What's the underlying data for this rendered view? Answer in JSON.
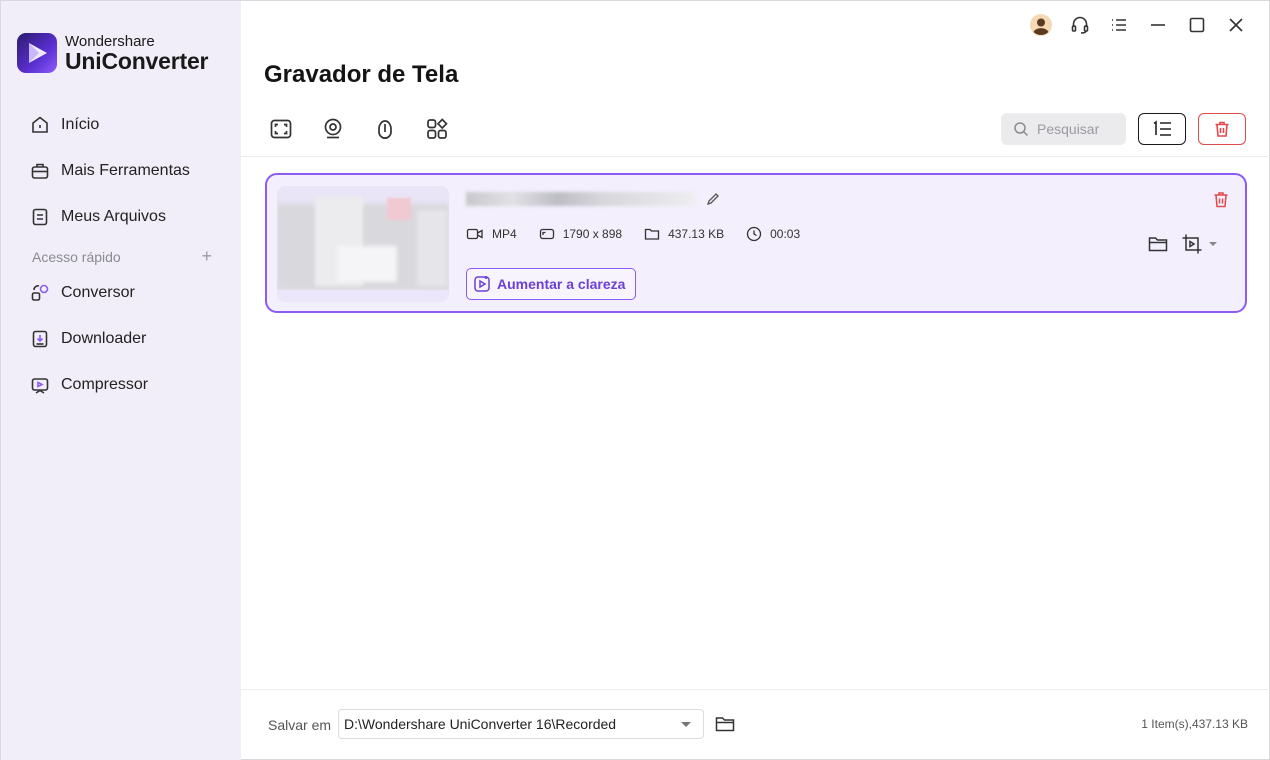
{
  "brand": {
    "top": "Wondershare",
    "main": "UniConverter"
  },
  "sidebar": {
    "items": [
      {
        "label": "Início",
        "icon": "home-icon"
      },
      {
        "label": "Mais Ferramentas",
        "icon": "toolbox-icon"
      },
      {
        "label": "Meus Arquivos",
        "icon": "files-icon"
      }
    ],
    "quick_access_label": "Acesso rápido",
    "quick_add": "+",
    "quick_items": [
      {
        "label": "Conversor",
        "icon": "converter-icon"
      },
      {
        "label": "Downloader",
        "icon": "downloader-icon"
      },
      {
        "label": "Compressor",
        "icon": "compressor-icon"
      }
    ]
  },
  "page": {
    "title": "Gravador de Tela"
  },
  "toolbar": {
    "icons": [
      "screen-record-icon",
      "webcam-record-icon",
      "audio-record-icon",
      "apps-grid-icon"
    ],
    "search_placeholder": "Pesquisar"
  },
  "item": {
    "format": "MP4",
    "resolution": "1790 x 898",
    "size": "437.13 KB",
    "duration": "00:03",
    "clarity_label": "Aumentar a clareza"
  },
  "footer": {
    "save_label": "Salvar em",
    "path": "D:\\Wondershare UniConverter 16\\Recorded",
    "summary": "1 Item(s),437.13 KB"
  },
  "colors": {
    "accent": "#8b5cf6",
    "danger": "#e04a4a",
    "sidebar_bg": "#f1eef9"
  }
}
